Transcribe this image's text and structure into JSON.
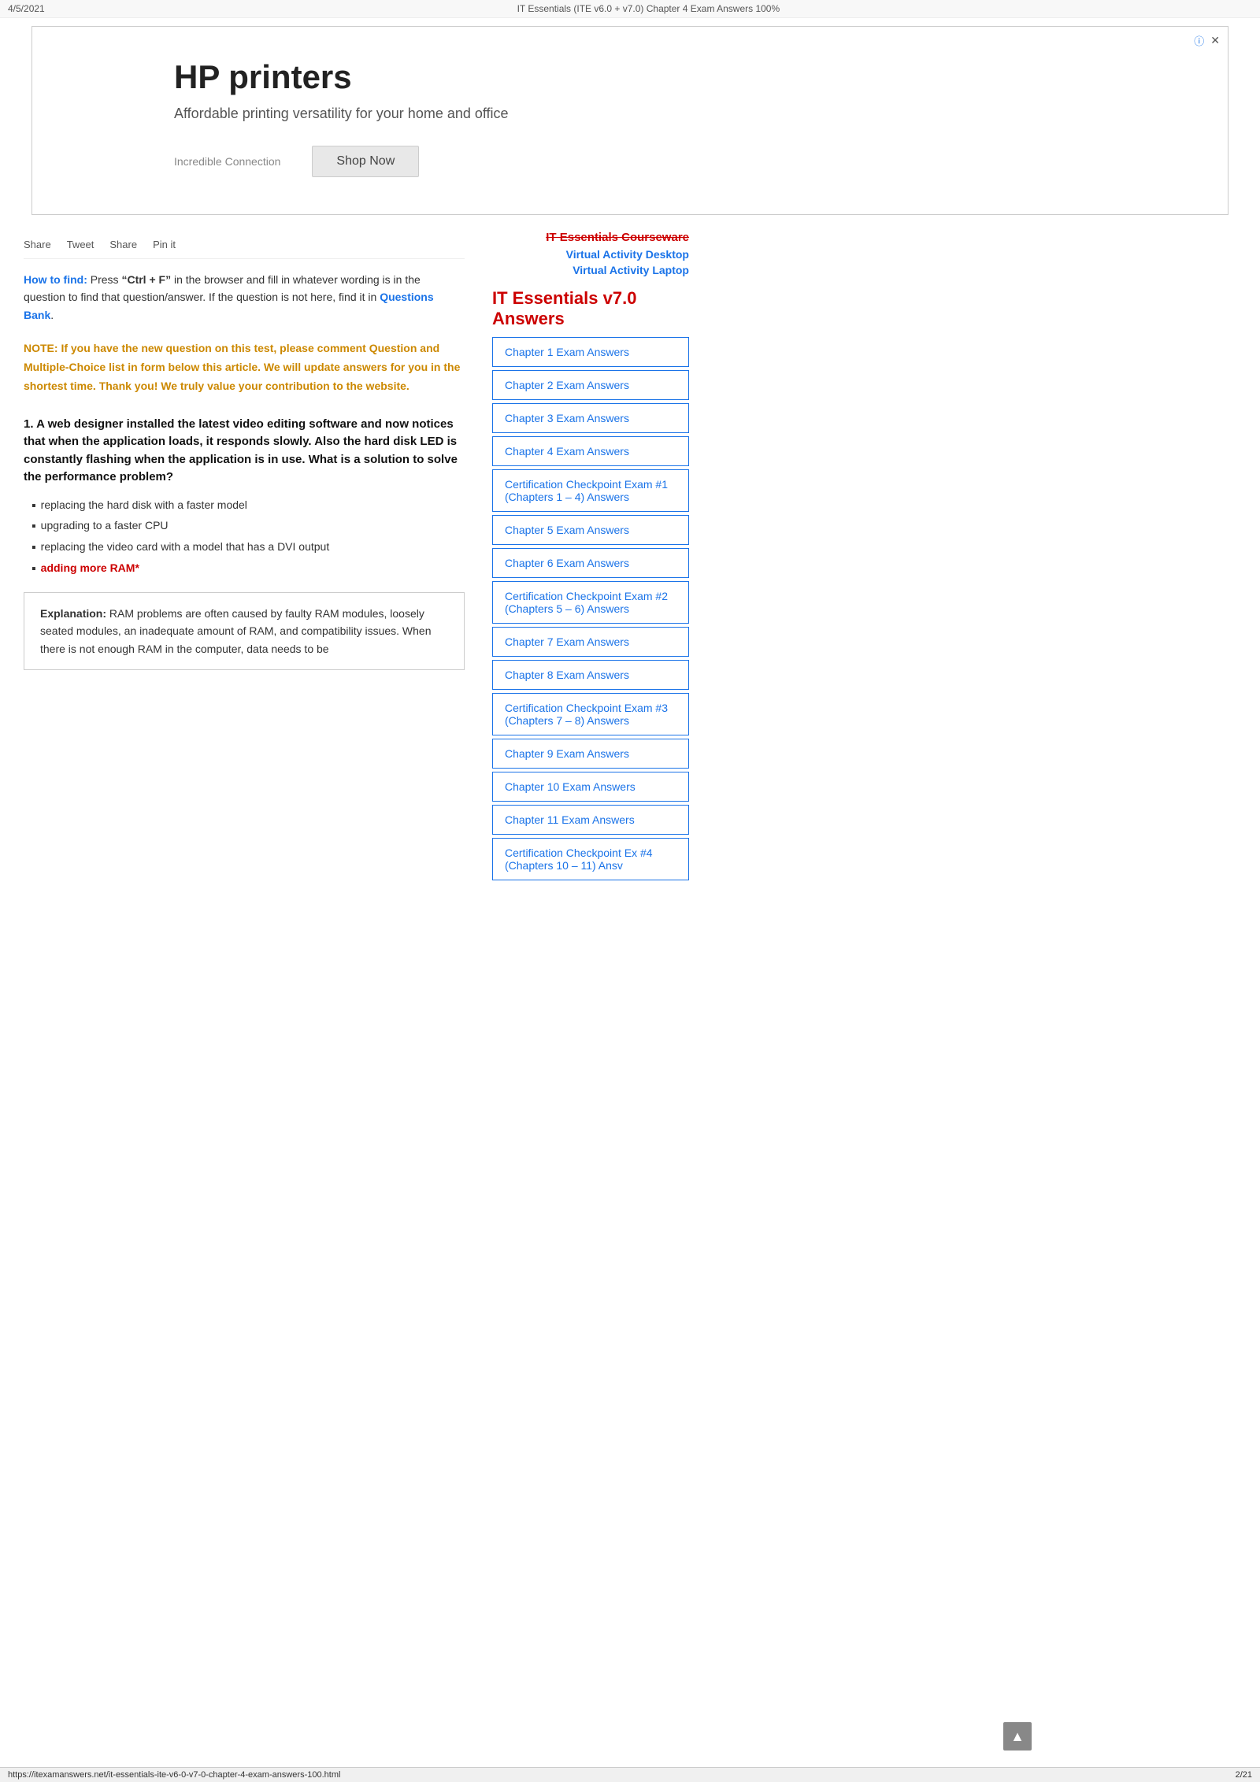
{
  "topbar": {
    "date": "4/5/2021",
    "title": "IT Essentials (ITE v6.0 + v7.0) Chapter 4 Exam Answers 100%"
  },
  "ad": {
    "info_icon": "ⓘ",
    "close_icon": "✕",
    "title": "HP printers",
    "subtitle": "Affordable printing versatility for your home and office",
    "brand": "Incredible Connection",
    "cta": "Shop Now"
  },
  "social": {
    "share1": "Share",
    "tweet": "Tweet",
    "share2": "Share",
    "pin": "Pin it"
  },
  "sidebar": {
    "top_title": "IT Essentials Courseware",
    "link1": "Virtual Activity Desktop",
    "link2": "Virtual Activity Laptop",
    "section_title": "IT Essentials v7.0 Answers",
    "chapters": [
      "Chapter 1 Exam Answers",
      "Chapter 2 Exam Answers",
      "Chapter 3 Exam Answers",
      "Chapter 4 Exam Answers",
      "Certification Checkpoint Exam #1 (Chapters 1 – 4) Answers",
      "Chapter 5 Exam Answers",
      "Chapter 6 Exam Answers",
      "Certification Checkpoint Exam #2 (Chapters 5 – 6) Answers",
      "Chapter 7 Exam Answers",
      "Chapter 8 Exam Answers",
      "Certification Checkpoint Exam #3 (Chapters 7 – 8) Answers",
      "Chapter 9 Exam Answers",
      "Chapter 10 Exam Answers",
      "Chapter 11 Exam Answers",
      "Certification Checkpoint Ex #4 (Chapters 10 – 11) Ansv"
    ]
  },
  "how_to_find": {
    "label": "How to find:",
    "text1": " Press ",
    "ctrl_f": "“Ctrl + F”",
    "text2": " in the browser and fill in whatever wording is in the question to find that question/answer. If the question is not here, find it in ",
    "questions_bank": "Questions Bank",
    "text3": "."
  },
  "note": {
    "text": "NOTE: If you have the new question on this test, please comment Question and Multiple-Choice list in form below this article. We will update answers for you in the shortest time. Thank you! We truly value your contribution to the website."
  },
  "question1": {
    "number": "1.",
    "text": " A web designer installed the latest video editing software and now notices that when the application loads, it responds slowly. Also the hard disk LED is constantly flashing when the application is in use. What is a solution to solve the performance problem?",
    "answers": [
      {
        "text": "replacing the hard disk with a faster model",
        "correct": false
      },
      {
        "text": "upgrading to a faster CPU",
        "correct": false
      },
      {
        "text": "replacing the video card with a model that has a DVI output",
        "correct": false
      },
      {
        "text": "adding more RAM*",
        "correct": true
      }
    ],
    "explanation_label": "Explanation:",
    "explanation_text": " RAM problems are often caused by faulty RAM modules, loosely seated modules, an inadequate amount of RAM, and compatibility issues. When there is not enough RAM in the computer, data needs to be"
  },
  "footer": {
    "url": "https://itexamanswers.net/it-essentials-ite-v6-0-v7-0-chapter-4-exam-answers-100.html",
    "page": "2/21"
  }
}
